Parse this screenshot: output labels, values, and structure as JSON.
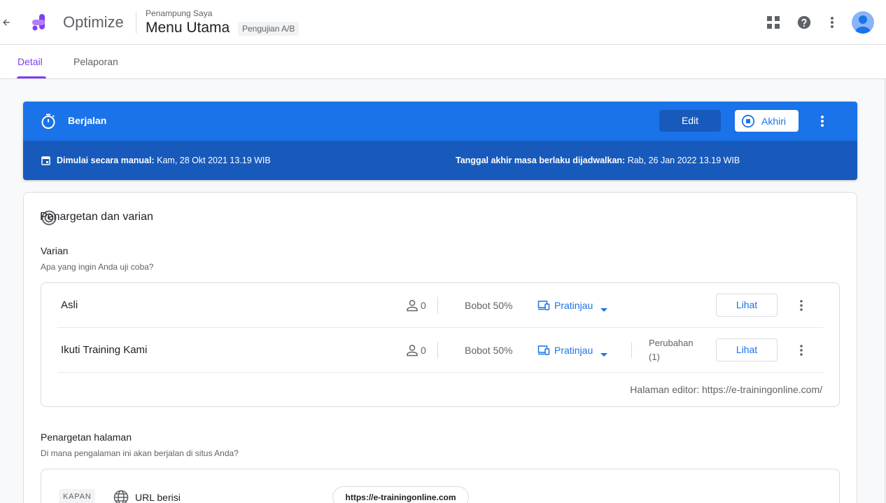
{
  "header": {
    "app_name": "Optimize",
    "container_label": "Penampung Saya",
    "page_title": "Menu Utama",
    "experiment_type": "Pengujian A/B"
  },
  "tabs": [
    {
      "label": "Detail",
      "active": true
    },
    {
      "label": "Pelaporan",
      "active": false
    }
  ],
  "status": {
    "label": "Berjalan",
    "edit_label": "Edit",
    "end_label": "Akhiri",
    "started_label": "Dimulai secara manual:",
    "started_value": "Kam, 28 Okt 2021 13.19 WIB",
    "end_date_label": "Tanggal akhir masa berlaku dijadwalkan:",
    "end_date_value": "Rab, 26 Jan 2022 13.19 WIB"
  },
  "targeting_card": {
    "title": "Penargetan dan varian",
    "variants_title": "Varian",
    "variants_subtitle": "Apa yang ingin Anda uji coba?",
    "variants": [
      {
        "name": "Asli",
        "users": "0",
        "weight": "Bobot 50%",
        "preview_label": "Pratinjau",
        "changes": "",
        "view_label": "Lihat"
      },
      {
        "name": "Ikuti Training Kami",
        "users": "0",
        "weight": "Bobot 50%",
        "preview_label": "Pratinjau",
        "changes": "Perubahan (1)",
        "view_label": "Lihat"
      }
    ],
    "editor_page": "Halaman editor: https://e-trainingonline.com/",
    "page_targeting_title": "Penargetan halaman",
    "page_targeting_subtitle": "Di mana pengalaman ini akan berjalan di situs Anda?",
    "rule": {
      "when": "KAPAN",
      "condition": "URL berisi",
      "value": "https://e-trainingonline.com"
    }
  },
  "colors": {
    "accent": "#7e3ff2",
    "banner": "#1a73e8",
    "banner_dark": "#185abc",
    "link": "#1a73e8"
  }
}
